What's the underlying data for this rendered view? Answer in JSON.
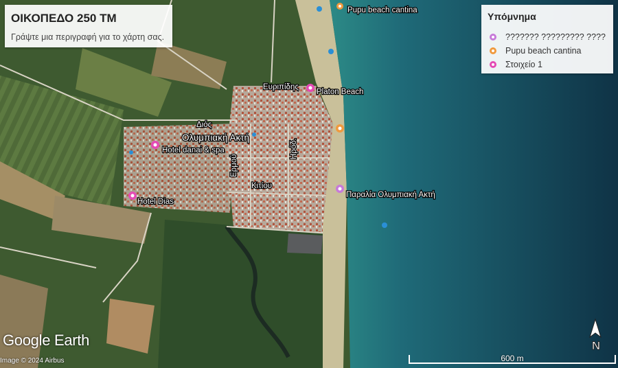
{
  "map": {
    "title": "ΟΙΚΟΠΕΔΟ 250 ΤΜ",
    "description": "Γράψτε μια περιγραφή για το χάρτη σας."
  },
  "legend": {
    "heading": "Υπόμνημα",
    "items": [
      {
        "label": "??????? ????????? ????",
        "color": "#c77ad9"
      },
      {
        "label": "Pupu beach cantina",
        "color": "#f09a3e"
      },
      {
        "label": "Στοιχείο 1",
        "color": "#e44bb5"
      }
    ]
  },
  "places": {
    "town": "Ολυμπιακή Ακτή",
    "hotel_danai": "Hotel danai & spa",
    "hotel_dias": "Hotel Dias",
    "platon_beach": "Platon Beach",
    "paralia": "Παραλία Ολυμπιακή Ακτή",
    "pupu_top": "Pupu beach cantina",
    "street_evripidis": "Ευριπίδης",
    "street_dios": "Διός",
    "street_ermou": "Ερμού",
    "street_irodotou": "Ηρόδ.",
    "street_kitiou": "Κιτίου"
  },
  "branding": {
    "logo": "Google Earth",
    "credit": "Image © 2024 Airbus"
  },
  "scale": {
    "label": "600 m"
  },
  "compass": {
    "label": "N"
  },
  "colors": {
    "sea_deep": "#123a4f",
    "sea_shallow": "#1f6f7a",
    "sand": "#c9c09a",
    "pin_pink": "#e44bb5",
    "pin_orange": "#f09a3e",
    "pin_blue": "#2a8fd6"
  }
}
